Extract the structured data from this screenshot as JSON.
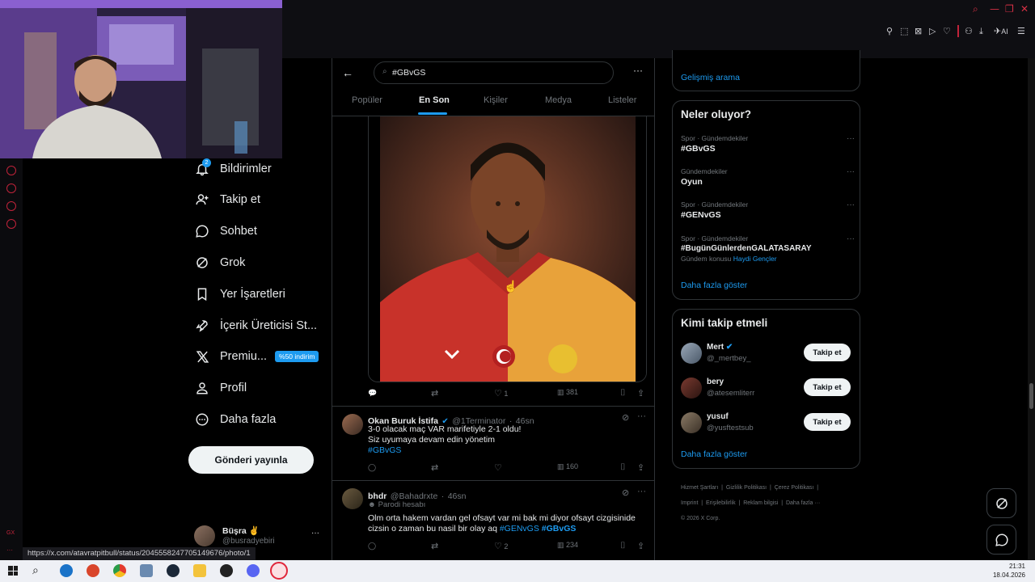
{
  "browser": {
    "status_url": "https://x.com/atavratpitbull/status/2045558247705149676/photo/1",
    "sidebar_gx": "GX",
    "ai_label": "AI"
  },
  "nav": {
    "notifications_badge": "2",
    "items": [
      {
        "label": "Bildirimler",
        "icon": "bell-icon"
      },
      {
        "label": "Takip et",
        "icon": "person-plus-icon"
      },
      {
        "label": "Sohbet",
        "icon": "chat-icon"
      },
      {
        "label": "Grok",
        "icon": "grok-icon"
      },
      {
        "label": "Yer İşaretleri",
        "icon": "bookmark-icon"
      },
      {
        "label": "İçerik Üreticisi St...",
        "icon": "rocket-icon"
      },
      {
        "label": "Premiu...",
        "icon": "x-logo-icon"
      },
      {
        "label": "Profil",
        "icon": "person-icon"
      },
      {
        "label": "Daha fazla",
        "icon": "more-circle-icon"
      }
    ],
    "premium_badge": "%50 indirim",
    "post_button": "Gönderi yayınla",
    "account": {
      "name": "Büşra ✌",
      "handle": "@busradyebiri"
    }
  },
  "search": {
    "query": "#GBvGS",
    "tabs": [
      "Popüler",
      "En Son",
      "Kişiler",
      "Medya",
      "Listeler"
    ],
    "active_tab": "En Son"
  },
  "tweets": [
    {
      "has_image": true,
      "actions": {
        "replies": "",
        "retweets": "",
        "likes": "1",
        "views": "381"
      }
    },
    {
      "name": "Okan Buruk İstifa",
      "handle": "@1Terminator",
      "time": "46sn",
      "lines": [
        "3-0 olacak maç VAR marifetiyle 2-1 oldu!",
        "Siz uyumaya devam edin yönetim"
      ],
      "hashtags": "#GBvGS",
      "actions": {
        "replies": "",
        "retweets": "",
        "likes": "",
        "views": "160"
      }
    },
    {
      "name": "bhdr",
      "handle": "@Bahadrxte",
      "time": "46sn",
      "label": "Parodi hesabı",
      "text": "Olm orta hakem vardan gel ofsayt var mi bak mi diyor ofsayt cizgisinide cizsin o zaman bu nasil bir olay aq",
      "hashtag1": "#GENvGS",
      "hashtag2": "#GBvGS",
      "actions": {
        "replies": "",
        "retweets": "",
        "likes": "2",
        "views": "234"
      }
    }
  ],
  "right": {
    "advanced_search": "Gelişmiş arama",
    "trends_title": "Neler oluyor?",
    "trends": [
      {
        "meta": "Spor · Gündemdekiler",
        "name": "#GBvGS",
        "extra": ""
      },
      {
        "meta": "Gündemdekiler",
        "name": "Oyun",
        "extra": ""
      },
      {
        "meta": "Spor · Gündemdekiler",
        "name": "#GENvGS",
        "extra": ""
      },
      {
        "meta": "Spor · Gündemdekiler",
        "name": "#BugünGünlerdenGALATASARAY",
        "extra_prefix": "Gündem konusu",
        "extra_link": "Haydi Gençler"
      }
    ],
    "show_more": "Daha fazla göster",
    "who_title": "Kimi takip etmeli",
    "who": [
      {
        "name": "Mert",
        "handle": "@_mertbey_",
        "verified": true
      },
      {
        "name": "bery",
        "handle": "@atesemliterr",
        "verified": false
      },
      {
        "name": "yusuf",
        "handle": "@yusftestsub",
        "verified": false
      }
    ],
    "follow_label": "Takip et",
    "show_more2": "Daha fazla göster",
    "footer": [
      "Hizmet Şartları",
      "Gizlilik Politikası",
      "Çerez Politikası",
      "Imprint",
      "Erişilebilirlik",
      "Reklam bilgisi",
      "Daha fazla ···",
      "© 2026 X Corp."
    ]
  },
  "taskbar": {
    "time": "21:31",
    "date": "18.04.2026"
  }
}
